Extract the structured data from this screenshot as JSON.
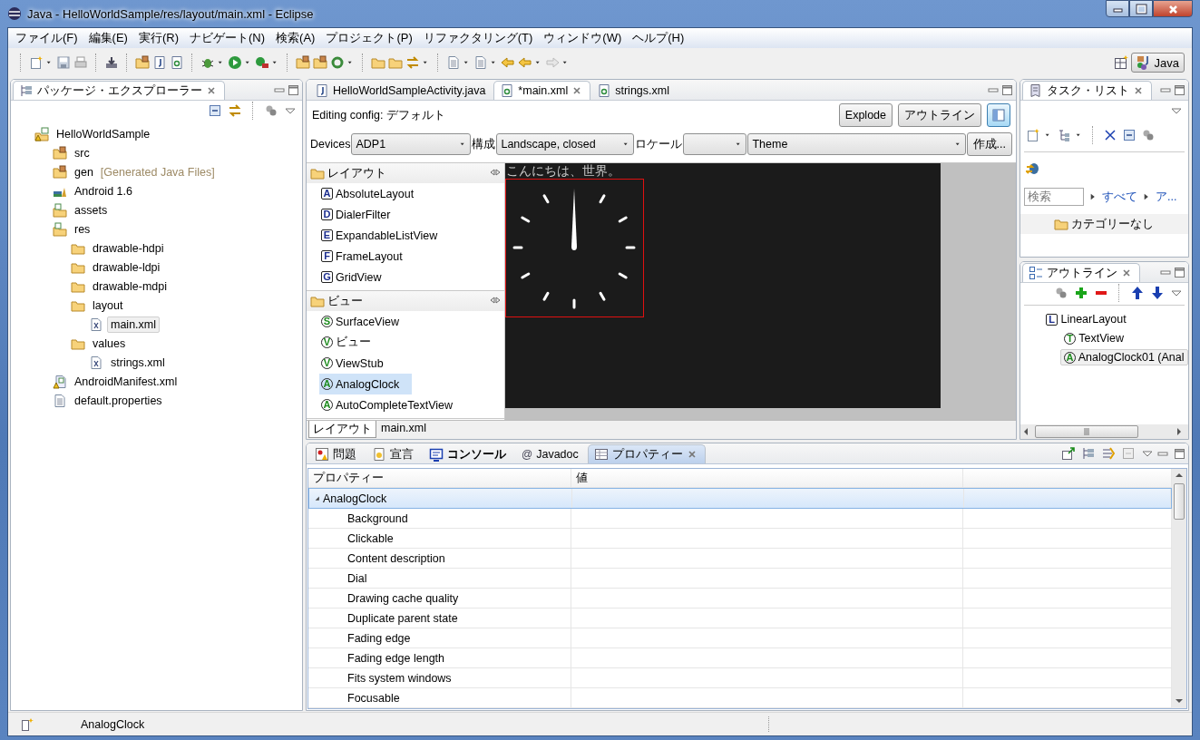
{
  "window": {
    "title": "Java - HelloWorldSample/res/layout/main.xml - Eclipse"
  },
  "menu": [
    "ファイル(F)",
    "編集(E)",
    "実行(R)",
    "ナビゲート(N)",
    "検索(A)",
    "プロジェクト(P)",
    "リファクタリング(T)",
    "ウィンドウ(W)",
    "ヘルプ(H)"
  ],
  "perspective": {
    "label": "Java",
    "selected": true
  },
  "package_explorer": {
    "title": "パッケージ・エクスプローラー",
    "tree": [
      {
        "label": "HelloWorldSample",
        "kind": "project",
        "selected": false,
        "children": [
          {
            "label": "src",
            "kind": "source-folder",
            "selected": false
          },
          {
            "label": "gen",
            "note": "[Generated Java Files]",
            "kind": "source-folder",
            "selected": false
          },
          {
            "label": "Android 1.6",
            "kind": "library",
            "selected": false
          },
          {
            "label": "assets",
            "kind": "resource-folder",
            "selected": false
          },
          {
            "label": "res",
            "kind": "resource-folder",
            "selected": false,
            "children": [
              {
                "label": "drawable-hdpi",
                "kind": "folder",
                "selected": false
              },
              {
                "label": "drawable-ldpi",
                "kind": "folder",
                "selected": false
              },
              {
                "label": "drawable-mdpi",
                "kind": "folder",
                "selected": false
              },
              {
                "label": "layout",
                "kind": "folder",
                "selected": false,
                "children": [
                  {
                    "label": "main.xml",
                    "kind": "xml",
                    "selected": true
                  }
                ]
              },
              {
                "label": "values",
                "kind": "folder",
                "selected": false,
                "children": [
                  {
                    "label": "strings.xml",
                    "kind": "xml",
                    "selected": false
                  }
                ]
              }
            ]
          },
          {
            "label": "AndroidManifest.xml",
            "kind": "manifest",
            "selected": false
          },
          {
            "label": "default.properties",
            "kind": "file",
            "selected": false
          }
        ]
      }
    ]
  },
  "editor": {
    "tabs": [
      {
        "label": "HelloWorldSampleActivity.java",
        "kind": "java",
        "selected": false
      },
      {
        "label": "*main.xml",
        "kind": "xml",
        "selected": true
      },
      {
        "label": "strings.xml",
        "kind": "xml",
        "selected": false
      }
    ],
    "config": "Editing config: デフォルト",
    "buttons": [
      "Explode",
      "アウトライン"
    ],
    "layout_toggle": {
      "selected": true
    },
    "selectors": [
      {
        "label": "Devices",
        "value": "ADP1"
      },
      {
        "label": "構成",
        "value": "Landscape, closed"
      },
      {
        "label": "ロケール"
      },
      {
        "value": "Theme"
      }
    ],
    "create_button": "作成...",
    "palette": [
      {
        "title": "レイアウト",
        "kind": "layout",
        "items": [
          {
            "letter": "A",
            "label": "AbsoluteLayout",
            "selected": false
          },
          {
            "letter": "D",
            "label": "DialerFilter",
            "selected": false
          },
          {
            "letter": "E",
            "label": "ExpandableListView",
            "selected": false
          },
          {
            "letter": "F",
            "label": "FrameLayout",
            "selected": false
          },
          {
            "letter": "G",
            "label": "GridView",
            "selected": false
          }
        ]
      },
      {
        "title": "ビュー",
        "kind": "view",
        "items": [
          {
            "letter": "S",
            "label": "SurfaceView",
            "selected": false
          },
          {
            "letter": "V",
            "label": "ビュー",
            "selected": false
          },
          {
            "letter": "V",
            "label": "ViewStub",
            "selected": false
          },
          {
            "letter": "A",
            "label": "AnalogClock",
            "selected": true
          },
          {
            "letter": "A",
            "label": "AutoCompleteTextView",
            "selected": false
          }
        ]
      }
    ],
    "preview": {
      "text": "こんにちは、世界。",
      "clock_selected": true
    },
    "bottom_tabs": [
      {
        "label": "レイアウト",
        "selected": true
      },
      {
        "label": "main.xml",
        "selected": false
      }
    ]
  },
  "task_list": {
    "title": "タスク・リスト",
    "search": {
      "placeholder": "検索"
    },
    "filters": [
      "すべて",
      "ア..."
    ],
    "category": "カテゴリーなし"
  },
  "outline": {
    "title": "アウトライン",
    "tree": [
      {
        "label": "LinearLayout",
        "letter": "L",
        "kind": "layout",
        "selected": false,
        "children": [
          {
            "label": "TextView",
            "letter": "T",
            "kind": "view",
            "selected": false
          },
          {
            "label": "AnalogClock01 (Anal",
            "letter": "A",
            "kind": "view",
            "selected": true
          }
        ]
      }
    ]
  },
  "bottom": {
    "tabs": [
      {
        "label": "問題",
        "kind": "problems",
        "selected": false
      },
      {
        "label": "宣言",
        "kind": "declaration",
        "selected": false
      },
      {
        "label": "コンソール",
        "kind": "console",
        "bold": true,
        "selected": false
      },
      {
        "label": "Javadoc",
        "kind": "javadoc",
        "glyph": "@",
        "selected": false
      },
      {
        "label": "プロパティー",
        "kind": "properties",
        "selected": true
      }
    ],
    "columns": [
      "プロパティー",
      "値"
    ],
    "rows": [
      {
        "label": "AnalogClock",
        "expanded": true,
        "selected": true,
        "children": [
          {
            "label": "Background",
            "selected": false
          },
          {
            "label": "Clickable",
            "selected": false
          },
          {
            "label": "Content description",
            "selected": false
          },
          {
            "label": "Dial",
            "selected": false
          },
          {
            "label": "Drawing cache quality",
            "selected": false
          },
          {
            "label": "Duplicate parent state",
            "selected": false
          },
          {
            "label": "Fading edge",
            "selected": false
          },
          {
            "label": "Fading edge length",
            "selected": false
          },
          {
            "label": "Fits system windows",
            "selected": false
          },
          {
            "label": "Focusable",
            "selected": false
          }
        ]
      }
    ]
  },
  "status_bar": {
    "text": "AnalogClock"
  }
}
